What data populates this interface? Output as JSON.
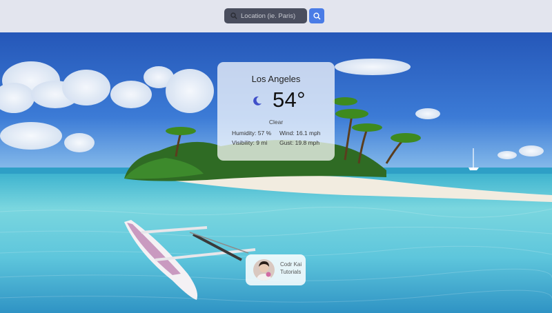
{
  "search": {
    "placeholder": "Location (ie. Paris)",
    "value": ""
  },
  "weather": {
    "city": "Los Angeles",
    "temperature": "54°",
    "condition": "Clear",
    "humidity": "Humidity: 57 %",
    "visibility": "Visibility: 9 mi",
    "wind": "Wind: 16.1 mph",
    "gust": "Gust: 19.8 mph",
    "icon": "moon-icon"
  },
  "credit": {
    "line1": "Codr Kai",
    "line2": "Tutorials"
  },
  "colors": {
    "topbar": "#e3e5ee",
    "search_bg": "#4a4e5e",
    "button": "#4a7ce6",
    "sky": "#2d66c4",
    "water": "#5cc8d8"
  }
}
